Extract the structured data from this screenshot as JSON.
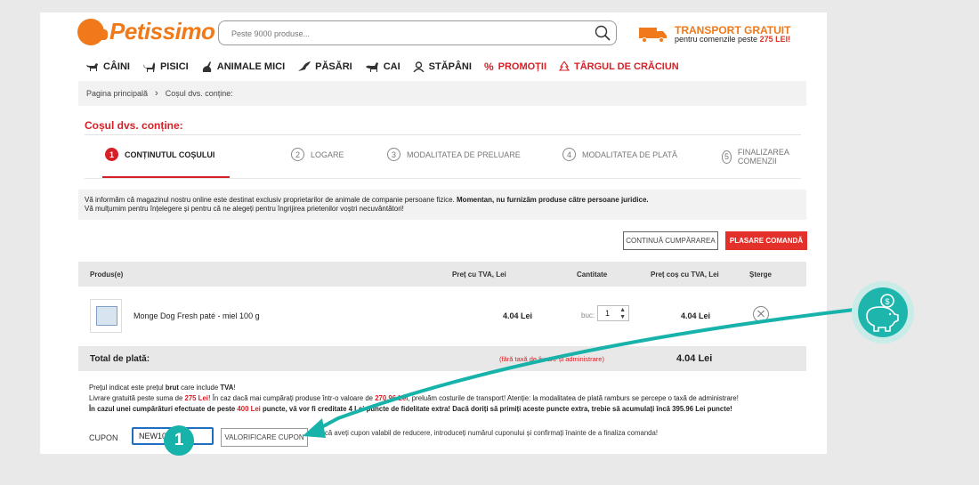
{
  "header": {
    "logo_text": "Petissimo",
    "search_placeholder": "Peste 9000 produse...",
    "transport_title_a": "TRANSPORT",
    "transport_title_b": "GRATUIT",
    "transport_sub_a": "pentru comenzile peste",
    "transport_sub_b": "275 LEI!"
  },
  "nav": {
    "items": [
      {
        "label": "CÂINI",
        "icon": "dog-icon"
      },
      {
        "label": "PISICI",
        "icon": "cat-icon"
      },
      {
        "label": "ANIMALE MICI",
        "icon": "rabbit-icon"
      },
      {
        "label": "PĂSĂRI",
        "icon": "bird-icon"
      },
      {
        "label": "CAI",
        "icon": "horse-icon"
      },
      {
        "label": "STĂPÂNI",
        "icon": "person-icon"
      },
      {
        "label": "PROMOȚII",
        "icon": "percent-icon",
        "color": "#d71f26"
      },
      {
        "label": "TÂRGUL DE CRĂCIUN",
        "icon": "tree-icon",
        "color": "#d71f26"
      }
    ]
  },
  "breadcrumb": {
    "home": "Pagina principală",
    "sep": "›",
    "current": "Coșul dvs. conține:"
  },
  "page_title": "Coșul dvs. conține:",
  "steps": [
    {
      "num": "1",
      "label": "CONȚINUTUL COȘULUI"
    },
    {
      "num": "2",
      "label": "LOGARE"
    },
    {
      "num": "3",
      "label": "MODALITATEA DE PRELUARE"
    },
    {
      "num": "4",
      "label": "MODALITATEA DE PLATĂ"
    },
    {
      "num": "5",
      "label": "FINALIZAREA COMENZII"
    }
  ],
  "info": {
    "line1_a": "Vă informăm că magazinul nostru online este destinat exclusiv proprietarilor de animale de companie persoane fizice.",
    "line1_b": "Momentan, nu furnizăm produse către persoane juridice.",
    "line2": "Vă mulțumim pentru înțelegere și pentru că ne alegeți pentru îngrijirea prietenilor voștri necuvântători!"
  },
  "buttons": {
    "continue": "CONTINUĂ CUMPĂRAREA",
    "order": "PLASARE COMANDĂ"
  },
  "table": {
    "headers": {
      "product": "Produs(e)",
      "price": "Preț cu TVA, Lei",
      "qty": "Cantitate",
      "cart_price": "Preț coș cu TVA, Lei",
      "delete": "Șterge"
    },
    "rows": [
      {
        "name": "Monge Dog Fresh paté - miel 100 g",
        "price": "4.04 Lei",
        "unit": "buc:",
        "qty": "1",
        "total": "4.04 Lei"
      }
    ],
    "total_label": "Total de plată:",
    "total_note": "(fără taxă de livrare și administrare)",
    "total_value": "4.04 Lei"
  },
  "notes": {
    "l1_a": "Prețul indicat este prețul",
    "l1_b": "brut",
    "l1_c": "care include",
    "l1_d": "TVA",
    "l1_e": "!",
    "l2_a": "Livrare gratuită peste suma de",
    "l2_b": "275 Lei!",
    "l2_c": "În caz dacă mai cumpărați produse într-o valoare de",
    "l2_d": "270.96 Lei",
    "l2_e": ", preluăm costurile de transport! Atenție: la modalitatea de plată ramburs se percepe o taxă de administrare!",
    "l3_a": "În cazul unei cumpărături efectuate de peste",
    "l3_b": "400 Lei",
    "l3_c": "puncte, vă vor fi creditate 4 Lei puncte de fidelitate extra! Dacă doriți să primiți aceste puncte extra, trebie să acumulați încă 395.96 Lei puncte!"
  },
  "coupon": {
    "label": "CUPON",
    "value": "NEW10",
    "button": "VALORIFICARE CUPON",
    "hint": "Dacă aveți cupon valabil de reducere, introduceți numărul cuponului și confirmați înainte de a finaliza comanda!"
  },
  "annotation": {
    "badge": "1",
    "accent": "#17b3aa"
  }
}
